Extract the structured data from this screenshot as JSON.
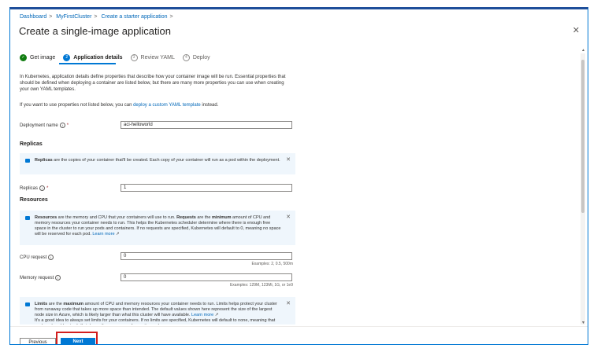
{
  "breadcrumb": [
    "Dashboard",
    "MyFirstCluster",
    "Create a starter application"
  ],
  "title": "Create a single-image application",
  "title_more": "...",
  "steps": [
    {
      "label": "Get image",
      "state": "done"
    },
    {
      "label": "Application details",
      "state": "active",
      "number": "2"
    },
    {
      "label": "Review YAML",
      "state": "pending",
      "number": "3"
    },
    {
      "label": "Deploy",
      "state": "pending",
      "number": "4"
    }
  ],
  "intro": {
    "p1": "In Kubernetes, application details define properties that describe how your container image will be run. Essential properties that should be defined when deploying a container are listed below, but there are many more properties you can use when creating your own YAML templates.",
    "p2_prefix": "If you want to use properties not listed below, you can ",
    "p2_link": "deploy a custom YAML template",
    "p2_suffix": " instead."
  },
  "fields": {
    "deployment_name": {
      "label": "Deployment name",
      "value": "aci-helloworld"
    },
    "replicas": {
      "label": "Replicas",
      "value": "1"
    },
    "cpu_request": {
      "label": "CPU request",
      "value": "0",
      "example": "Examples: 2, 0.5, 500m"
    },
    "memory_request": {
      "label": "Memory request",
      "value": "0",
      "example": "Examples: 129M, 123Mi, 1G, or 1e9"
    }
  },
  "sections": {
    "replicas": "Replicas",
    "resources": "Resources"
  },
  "info_replicas": {
    "bold": "Replicas",
    "text": " are the copies of your container that'll be created. Each copy of your container will run as a pod within the deployment."
  },
  "info_resources": {
    "bold1": "Resources",
    "text1": " are the memory and CPU that your containers will use to run. ",
    "bold2": "Requests",
    "text2": " are the ",
    "bold3": "minimum",
    "text3": " amount of CPU and memory resources your container needs to run. This helps the Kubernetes scheduler determine where there is enough free space in the cluster to run your pods and containers. If no requests are specified, Kubernetes will default to 0, meaning no space will be reserved for each pod. ",
    "link": "Learn more"
  },
  "info_limits": {
    "bold1": "Limits",
    "text1": " are the ",
    "bold2": "maximum",
    "text2": " amount of CPU and memory resources your container needs to run. Limits helps protect your cluster from runaway code that takes up more space than intended. The default values shown here represent the size of the largest node size in Azure, which is likely larger than what this cluster will have available. ",
    "link": "Learn more",
    "text3": "It's a good idea to always set limits for your containers. If no limits are specified, Kubernetes will default to none, meaning that each pod could potentially take up the resources of an entire node."
  },
  "footer": {
    "previous": "Previous",
    "next": "Next"
  },
  "colors": {
    "accent": "#0078d4",
    "success": "#107c10",
    "highlight": "#d21e1e"
  }
}
